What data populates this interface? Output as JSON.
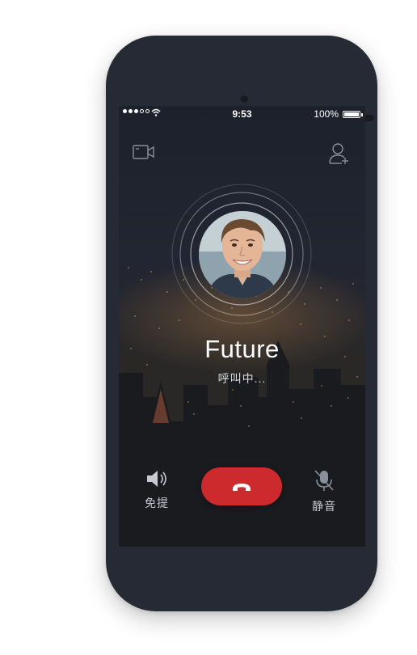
{
  "status_bar": {
    "time": "9:53",
    "battery": "100%",
    "signal_icon": "signal-dots-icon",
    "wifi_icon": "wifi-icon",
    "battery_icon": "battery-icon"
  },
  "top_bar": {
    "left_icon": "video-camera-icon",
    "right_icon": "add-user-icon"
  },
  "call": {
    "name": "Future",
    "status": "呼叫中..."
  },
  "controls": {
    "speaker_label": "免提",
    "speaker_icon": "speaker-icon",
    "hangup_icon": "phone-hangup-icon",
    "mute_label": "静音",
    "mute_icon": "mic-muted-icon",
    "hangup_color": "#cc2a2c"
  }
}
